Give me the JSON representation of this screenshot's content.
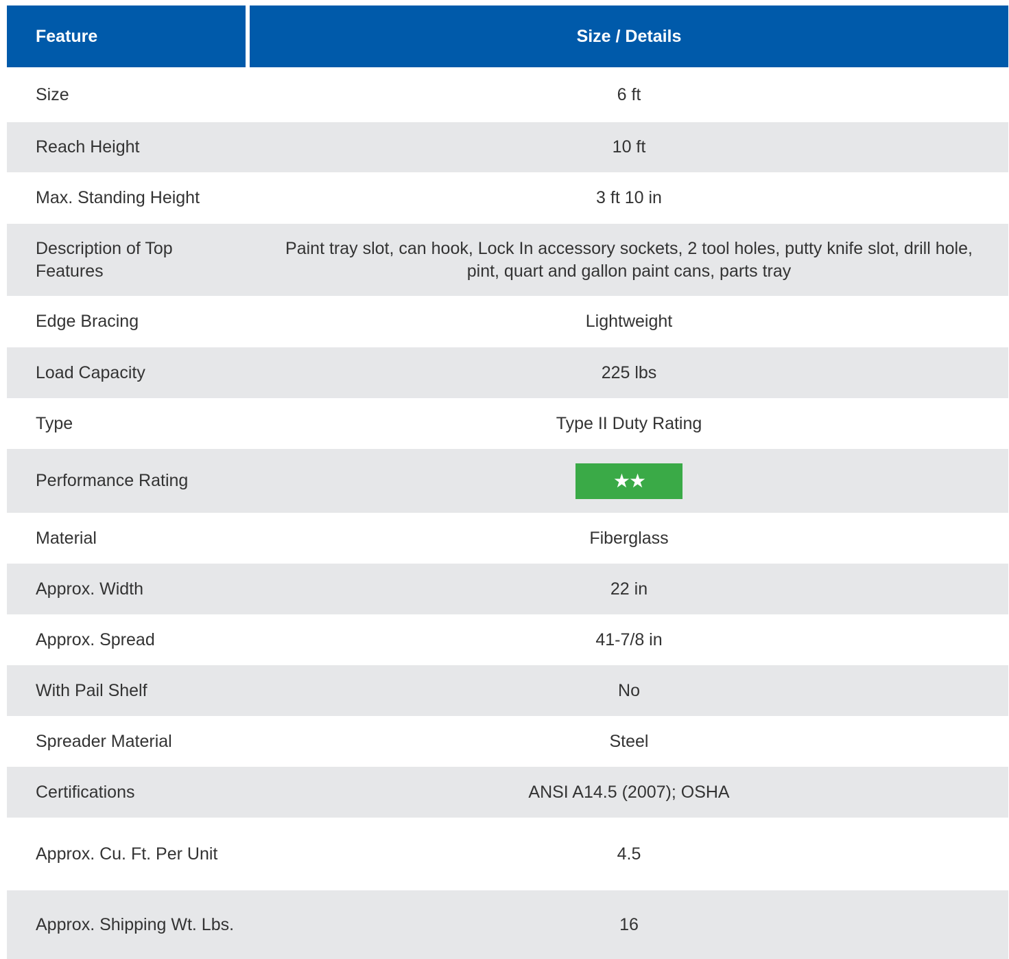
{
  "table": {
    "header": {
      "feature": "Feature",
      "details": "Size / Details"
    },
    "rows": [
      {
        "feature": "Size",
        "value": "6 ft"
      },
      {
        "feature": "Reach Height",
        "value": "10 ft"
      },
      {
        "feature": "Max. Standing Height",
        "value": "3 ft 10 in"
      },
      {
        "feature": "Description of Top Features",
        "value": "Paint tray slot, can hook, Lock In accessory sockets, 2 tool holes, putty knife slot, drill hole, pint, quart and gallon paint cans, parts tray"
      },
      {
        "feature": "Edge Bracing",
        "value": "Lightweight"
      },
      {
        "feature": "Load Capacity",
        "value": "225 lbs"
      },
      {
        "feature": "Type",
        "value": "Type II Duty Rating"
      },
      {
        "feature": "Performance Rating",
        "value": "★★",
        "stars": 2
      },
      {
        "feature": "Material",
        "value": "Fiberglass"
      },
      {
        "feature": "Approx. Width",
        "value": "22 in"
      },
      {
        "feature": "Approx. Spread",
        "value": "41-7/8 in"
      },
      {
        "feature": "With Pail Shelf",
        "value": "No"
      },
      {
        "feature": "Spreader Material",
        "value": "Steel"
      },
      {
        "feature": "Certifications",
        "value": "ANSI A14.5 (2007); OSHA"
      },
      {
        "feature": "Approx. Cu. Ft. Per Unit",
        "value": "4.5"
      },
      {
        "feature": "Approx. Shipping Wt. Lbs.",
        "value": "16"
      }
    ]
  },
  "colors": {
    "header_bg": "#005aaa",
    "row_alt_bg": "#e6e7e9",
    "rating_badge": "#3aaa47"
  }
}
